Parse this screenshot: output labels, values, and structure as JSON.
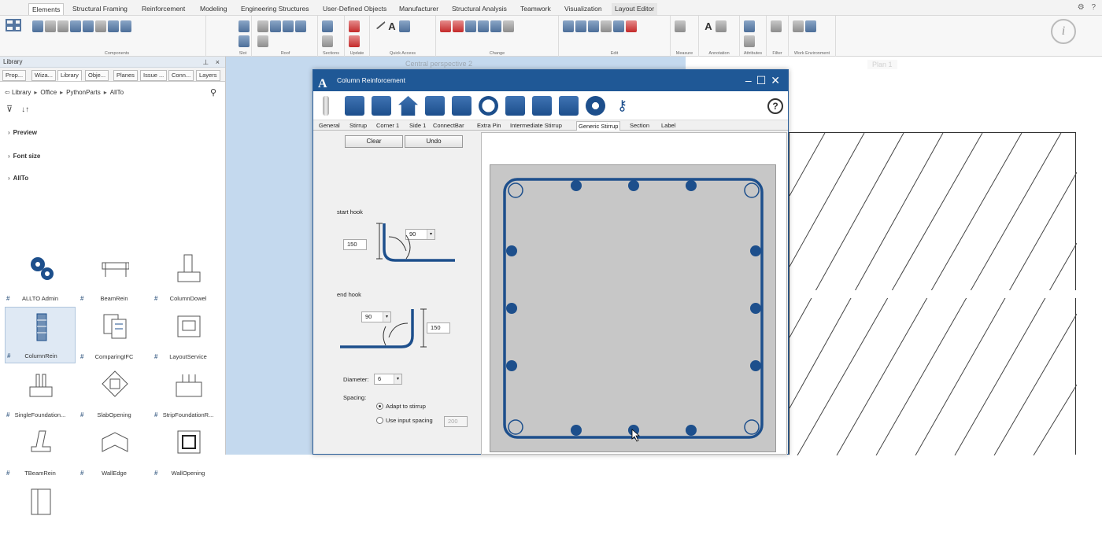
{
  "menubar": {
    "tabs": [
      "Elements",
      "Structural Framing",
      "Reinforcement",
      "Modeling",
      "Engineering Structures",
      "User-Defined Objects",
      "Manufacturer",
      "Structural Analysis",
      "Teamwork",
      "Visualization",
      "Layout Editor"
    ],
    "active_tab": "Elements"
  },
  "ribbon": {
    "groups": [
      "Components",
      "Slot",
      "Roof",
      "Sections",
      "Update",
      "Quick Access",
      "Change",
      "Edit",
      "Measure",
      "Annotation",
      "Attributes",
      "Filter",
      "Work Environment"
    ]
  },
  "views": {
    "perspective_label": "Central perspective 2",
    "plan_label": "Plan 1"
  },
  "library_panel": {
    "title": "Library",
    "tabs": [
      "Prop...",
      "Wiza...",
      "Library",
      "Obje...",
      "Planes",
      "Issue ...",
      "Conn...",
      "Layers"
    ],
    "active_tab": "Library",
    "breadcrumb": [
      "Library",
      "Office",
      "PythonParts",
      "AllTo"
    ],
    "sections": {
      "preview": "Preview",
      "font_size": "Font size",
      "allto": "AllTo"
    },
    "items": [
      {
        "label": "ALLTO Admin",
        "icon": "admin-gears-icon"
      },
      {
        "label": "BeamRein",
        "icon": "beam-reinforcement-icon"
      },
      {
        "label": "ColumnDowel",
        "icon": "column-dowel-icon"
      },
      {
        "label": "ColumnRein",
        "icon": "column-reinforcement-icon",
        "selected": true
      },
      {
        "label": "ComparingIFC",
        "icon": "compare-documents-icon"
      },
      {
        "label": "LayoutService",
        "icon": "layout-service-icon"
      },
      {
        "label": "SingleFoundation...",
        "icon": "single-foundation-icon"
      },
      {
        "label": "SlabOpening",
        "icon": "slab-opening-icon"
      },
      {
        "label": "StripFoundationR...",
        "icon": "strip-foundation-icon"
      },
      {
        "label": "TBeamRein",
        "icon": "t-beam-icon"
      },
      {
        "label": "WallEdge",
        "icon": "wall-edge-icon"
      },
      {
        "label": "WallOpening",
        "icon": "wall-opening-icon"
      },
      {
        "label": "",
        "icon": "wall-panel-icon"
      }
    ]
  },
  "dialog": {
    "title": "Column Reinforcement",
    "tabs": [
      "General",
      "Stirrup",
      "Corner 1",
      "Side 1",
      "ConnectBar",
      "Extra Pin",
      "Intermediate Stirrup",
      "Generic Stirrup",
      "Section",
      "Label"
    ],
    "active_tab": "Generic Stirrup",
    "buttons": {
      "clear": "Clear",
      "undo": "Undo"
    },
    "start_hook": {
      "label": "start hook",
      "length": "150",
      "angle": "90"
    },
    "end_hook": {
      "label": "end hook",
      "length": "150",
      "angle": "90"
    },
    "diameter": {
      "label": "Diameter:",
      "value": "6"
    },
    "spacing": {
      "label": "Spacing:",
      "option_adapt": "Adapt to stirrup",
      "option_input": "Use input spacing",
      "input_value": "200",
      "selected": "adapt"
    },
    "help": "?"
  },
  "colors": {
    "title_blue": "#1f5896",
    "rebar_blue": "#1d4f8c",
    "concrete_gray": "#c7c7c7"
  }
}
